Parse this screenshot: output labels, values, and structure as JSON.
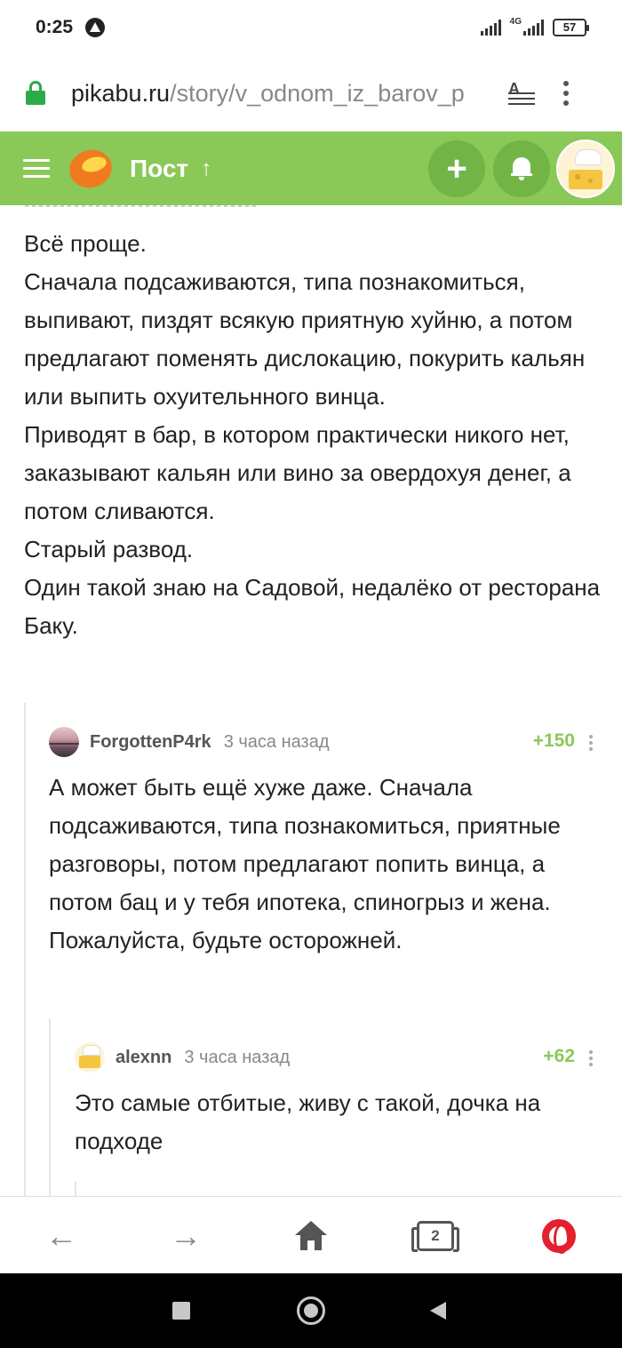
{
  "status": {
    "time": "0:25",
    "network": "4G",
    "battery": "57"
  },
  "browser": {
    "url_host": "pikabu.ru",
    "url_path": "/story/v_odnom_iz_barov_p"
  },
  "header": {
    "title": "Пост",
    "plus": "+"
  },
  "post": {
    "lines": [
      "Всё проще.",
      "Сначала подсаживаются, типа познакомиться, выпивают, пиздят всякую приятную хуйню, а потом предлагают поменять дислокацию, покурить кальян или выпить охуительнного винца.",
      "Приводят в бар, в котором практически никого нет, заказывают кальян или вино за овердохуя денег, а потом сливаются.",
      "Старый развод.",
      "Один такой знаю на Садовой, недалёко от ресторана Баку."
    ]
  },
  "comments": [
    {
      "user": "ForgottenP4rk",
      "time": "3 часа назад",
      "rating": "+150",
      "text": "А может быть ещё хуже даже. Сначала подсаживаются, типа познакомиться, приятные разговоры, потом предлагают попить винца, а потом бац и у тебя ипотека, спиногрыз и жена. Пожалуйста, будьте осторожней."
    },
    {
      "user": "alexnn",
      "time": "3 часа назад",
      "rating": "+62",
      "text": "Это самые отбитые, живу с такой, дочка на подходе"
    }
  ],
  "bottom_nav": {
    "back": "←",
    "forward": "→",
    "tabs_count": "2"
  },
  "colors": {
    "brand_green": "#8ac858",
    "rating_green": "#8ac858",
    "opera_red": "#e4202e"
  }
}
